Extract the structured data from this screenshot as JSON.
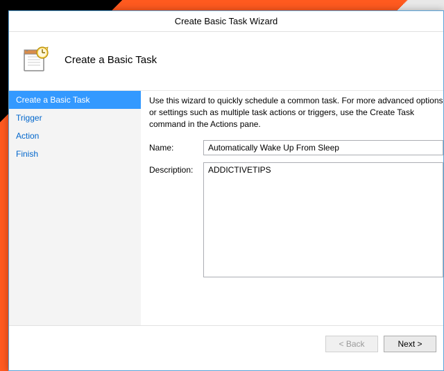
{
  "window": {
    "title": "Create Basic Task Wizard"
  },
  "header": {
    "title": "Create a Basic Task"
  },
  "sidebar": {
    "items": [
      {
        "label": "Create a Basic Task"
      },
      {
        "label": "Trigger"
      },
      {
        "label": "Action"
      },
      {
        "label": "Finish"
      }
    ]
  },
  "content": {
    "instructions": "Use this wizard to quickly schedule a common task.  For more advanced options or settings such as multiple task actions or triggers, use the Create Task command in the Actions pane.",
    "name_label": "Name:",
    "name_value": "Automatically Wake Up From Sleep",
    "description_label": "Description:",
    "description_value": "ADDICTIVETIPS"
  },
  "footer": {
    "back_label": "< Back",
    "next_label": "Next >"
  }
}
